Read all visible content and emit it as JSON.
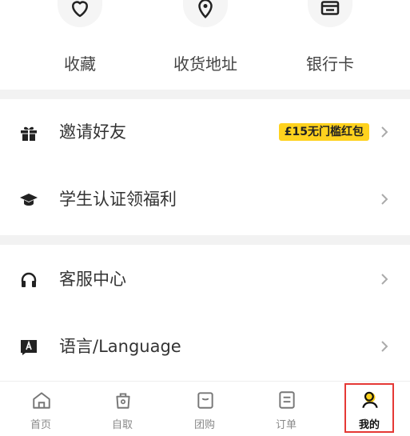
{
  "shortcuts": [
    {
      "label": "收藏",
      "icon": "heart-icon"
    },
    {
      "label": "收货地址",
      "icon": "location-pin-icon"
    },
    {
      "label": "银行卡",
      "icon": "bank-card-icon"
    }
  ],
  "menu1": [
    {
      "label": "邀请好友",
      "icon": "gift-icon",
      "badge": "£15无门槛红包"
    },
    {
      "label": "学生认证领福利",
      "icon": "graduation-cap-icon"
    }
  ],
  "menu2": [
    {
      "label": "客服中心",
      "icon": "headphones-icon"
    },
    {
      "label": "语言/Language",
      "icon": "language-icon"
    }
  ],
  "tabs": [
    {
      "label": "首页",
      "icon": "home-icon"
    },
    {
      "label": "自取",
      "icon": "pickup-bag-icon"
    },
    {
      "label": "团购",
      "icon": "group-buy-icon"
    },
    {
      "label": "订单",
      "icon": "orders-icon"
    },
    {
      "label": "我的",
      "icon": "profile-icon",
      "active": true
    }
  ],
  "colors": {
    "accent": "#ffd21e",
    "highlight_frame": "#e53935",
    "separator": "#f2f2f2"
  }
}
